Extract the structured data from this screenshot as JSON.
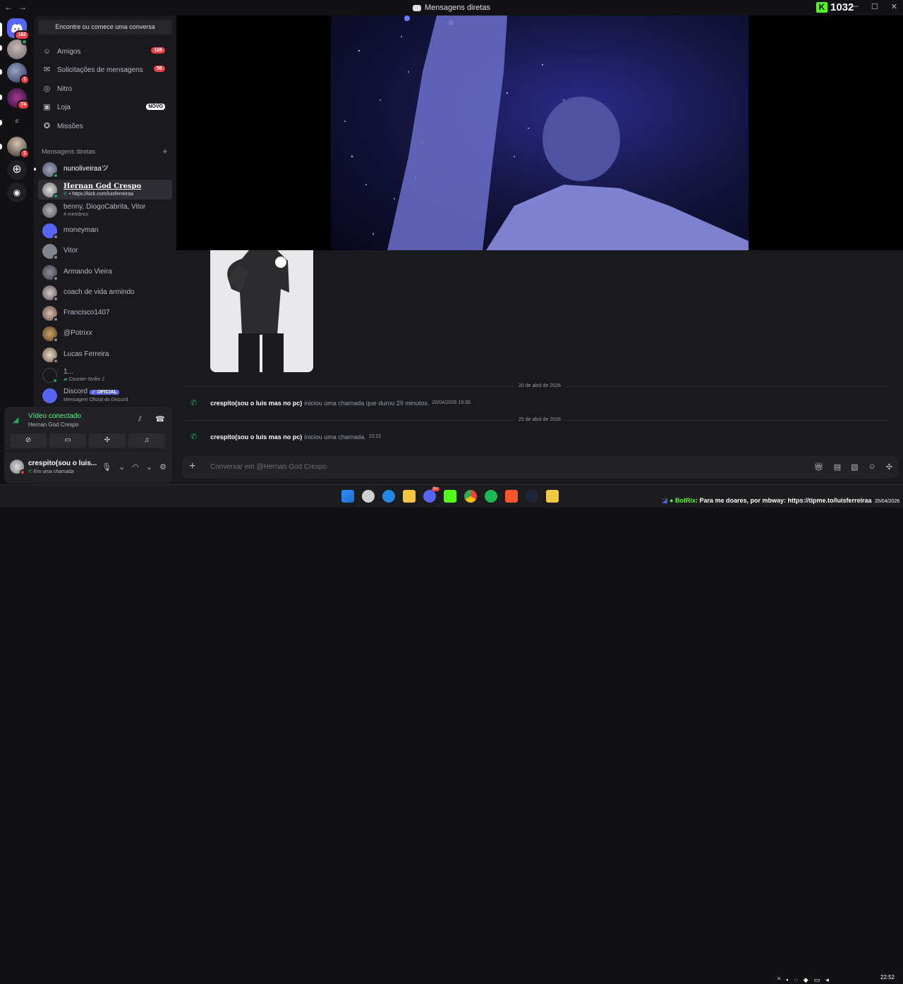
{
  "window": {
    "title": "Mensagens diretas",
    "back": "←",
    "forward": "→"
  },
  "overlay": {
    "kick_count": "1032",
    "kick_logo": "K"
  },
  "guilds": [
    {
      "name": "home",
      "badge": "162"
    },
    {
      "name": "server-2",
      "badge": ""
    },
    {
      "name": "server-3",
      "badge": "1"
    },
    {
      "name": "server-4",
      "badge": "74"
    },
    {
      "name": "server-5",
      "label": "c",
      "badge": ""
    },
    {
      "name": "server-6",
      "badge": "1"
    }
  ],
  "sidebar": {
    "search_label": "Encontre ou comece uma conversa",
    "nav": [
      {
        "label": "Amigos",
        "badge": "106"
      },
      {
        "label": "Solicitações de mensagens",
        "badge": "56"
      },
      {
        "label": "Nitro",
        "badge": ""
      },
      {
        "label": "Loja",
        "tag": "NOVO"
      },
      {
        "label": "Missões",
        "badge": ""
      }
    ],
    "dm_header": "Mensagens diretas",
    "dms": [
      {
        "name": "nunoliveiraaツ",
        "sub": ""
      },
      {
        "name": "Hernan God Crespo",
        "sub": "• https://kick.com/luisferreiraa"
      },
      {
        "name": "benny, DiogoCabrita, Vitor",
        "sub": "4 membros"
      },
      {
        "name": "moneyman",
        "sub": ""
      },
      {
        "name": "Vitor",
        "sub": ""
      },
      {
        "name": "Armando Vieira",
        "sub": ""
      },
      {
        "name": "coach de vida armindo",
        "sub": ""
      },
      {
        "name": "Francisco1407",
        "sub": ""
      },
      {
        "name": "@Potrixx",
        "sub": ""
      },
      {
        "name": "Lucas Ferreira",
        "sub": ""
      },
      {
        "name": "1...",
        "sub": "Counter-Strike 2"
      },
      {
        "name": "Discord",
        "sub": "Mensagem Oficial do Discord",
        "tag": "OFICIAL"
      }
    ]
  },
  "voice": {
    "status": "Vídeo conectado",
    "channel": "Hernan God Crespo"
  },
  "user": {
    "name": "crespito(sou o luis...",
    "status": "Em uma chamada"
  },
  "chat": {
    "dividers": [
      "20 de abril de 2026",
      "25 de abril de 2026"
    ],
    "messages": [
      {
        "author": "crespito(sou o luis mas no pc)",
        "text": "iniciou uma chamada que durou 29 minutos.",
        "time": "20/04/2026 19:35"
      },
      {
        "author": "crespito(sou o luis mas no pc)",
        "text": "iniciou uma chamada.",
        "time": "22:22"
      }
    ],
    "composer_placeholder": "Conversar em @Hernan God Crespo"
  },
  "taskbar": {
    "discord_badge": "9+",
    "botrix_name": "BotRix",
    "botrix_text": ": Para me doares, por mbway: https://tipme.to/luisferreiraa",
    "time": "22:52",
    "date": "25/04/2026"
  },
  "colors": {
    "accent": "#5865f2",
    "online": "#23a55a",
    "danger": "#f23f43",
    "kick": "#53fc18"
  }
}
